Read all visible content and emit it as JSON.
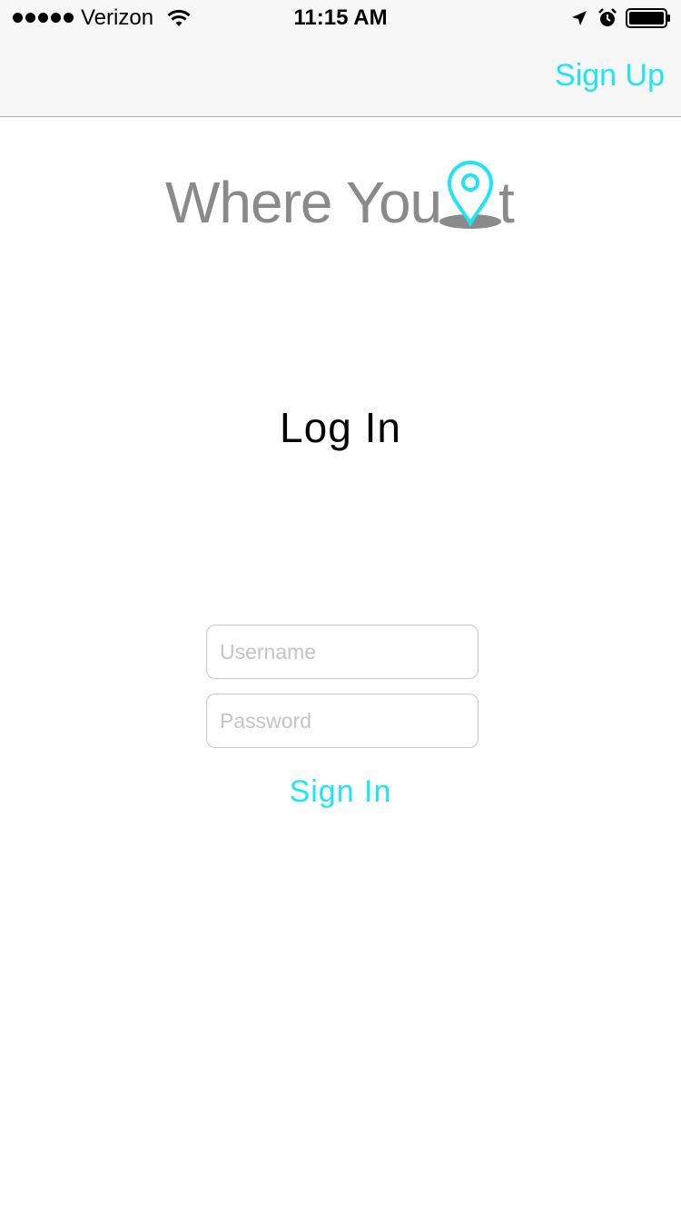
{
  "status_bar": {
    "carrier": "Verizon",
    "time": "11:15 AM"
  },
  "nav": {
    "signup_label": "Sign Up"
  },
  "logo": {
    "text": "Where You",
    "trailing": "t"
  },
  "page": {
    "title": "Log In"
  },
  "form": {
    "username_placeholder": "Username",
    "password_placeholder": "Password",
    "signin_label": "Sign In"
  },
  "colors": {
    "accent": "#1fe4f5",
    "logo_gray": "#8a8a8a",
    "nav_background": "#f7f7f7"
  },
  "icons": [
    "signal-dots-icon",
    "wifi-icon",
    "location-arrow-icon",
    "alarm-icon",
    "battery-icon",
    "map-pin-icon"
  ]
}
